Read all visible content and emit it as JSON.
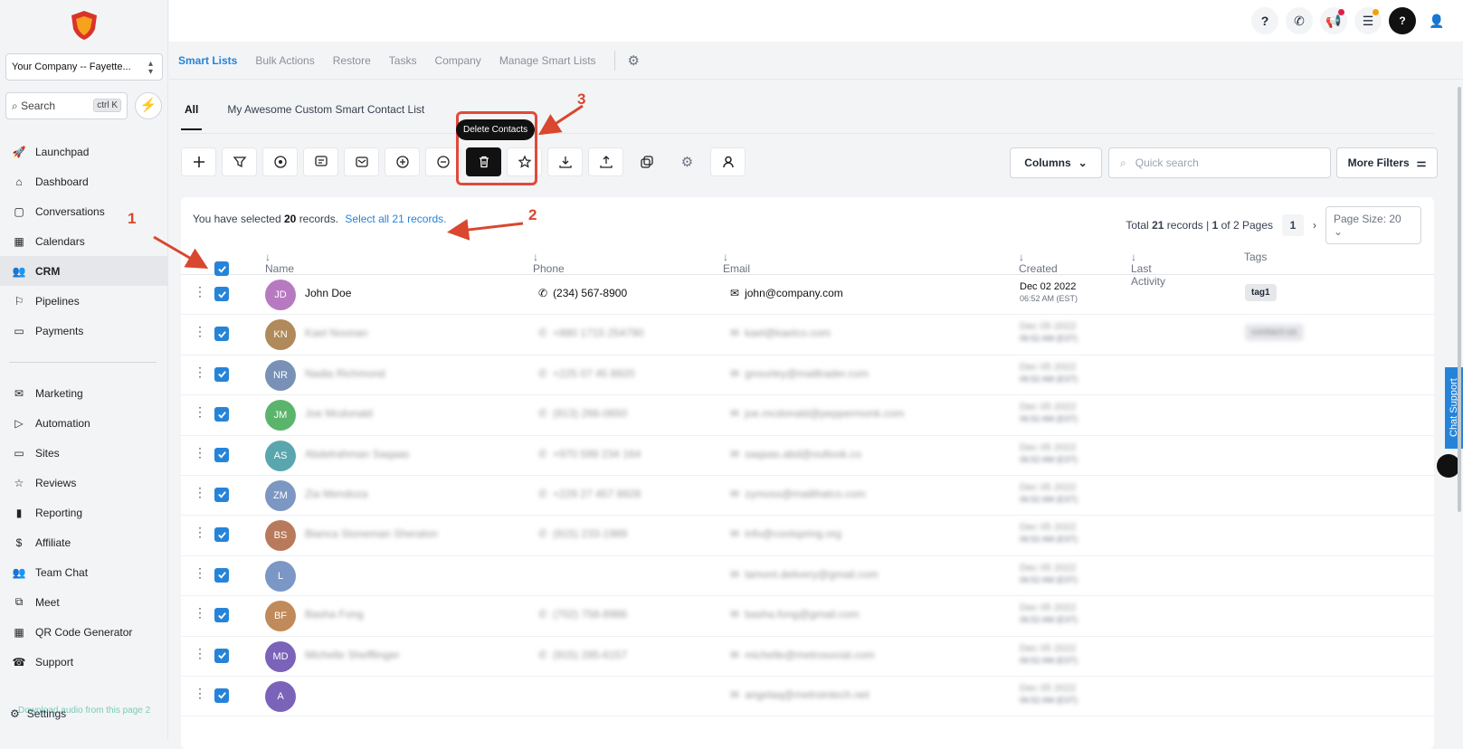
{
  "sidebar": {
    "company": "Your Company -- Fayette...",
    "search_placeholder": "Search",
    "search_shortcut": "ctrl K",
    "nav_primary": [
      {
        "label": "Launchpad",
        "icon": "rocket-icon"
      },
      {
        "label": "Dashboard",
        "icon": "home-icon"
      },
      {
        "label": "Conversations",
        "icon": "chat-icon"
      },
      {
        "label": "Calendars",
        "icon": "calendar-icon"
      },
      {
        "label": "CRM",
        "icon": "users-icon",
        "active": true
      },
      {
        "label": "Pipelines",
        "icon": "flag-icon"
      },
      {
        "label": "Payments",
        "icon": "payments-icon"
      }
    ],
    "nav_secondary": [
      {
        "label": "Marketing",
        "icon": "mail-icon"
      },
      {
        "label": "Automation",
        "icon": "play-icon"
      },
      {
        "label": "Sites",
        "icon": "monitor-icon"
      },
      {
        "label": "Reviews",
        "icon": "star-icon"
      },
      {
        "label": "Reporting",
        "icon": "bar-chart-icon"
      },
      {
        "label": "Affiliate",
        "icon": "dollar-icon"
      },
      {
        "label": "Team Chat",
        "icon": "team-icon"
      },
      {
        "label": "Meet",
        "icon": "cast-icon"
      },
      {
        "label": "QR Code Generator",
        "icon": "qr-icon"
      },
      {
        "label": "Support",
        "icon": "support-icon"
      }
    ],
    "settings_label": "Settings",
    "audio_overlay": "Download audio from this page",
    "audio_overlay_count": "2"
  },
  "tabs_top": [
    "Smart Lists",
    "Bulk Actions",
    "Restore",
    "Tasks",
    "Company",
    "Manage Smart Lists"
  ],
  "tabs_lists": [
    "All",
    "My Awesome Custom Smart Contact List"
  ],
  "tooltip": "Delete Contacts",
  "columns_label": "Columns",
  "quick_search_placeholder": "Quick search",
  "more_filters_label": "More Filters",
  "selection": {
    "prefix": "You have selected",
    "count": "20",
    "suffix": "records.",
    "select_all": "Select all 21 records."
  },
  "pager": {
    "total_prefix": "Total",
    "total": "21",
    "total_mid": "records |",
    "page": "1",
    "of_text": "of 2 Pages",
    "current": "1",
    "page_size": "Page Size: 20"
  },
  "columns": [
    "Name",
    "Phone",
    "Email",
    "Created",
    "Last Activity",
    "Tags"
  ],
  "rows": [
    {
      "initials": "JD",
      "color": "#b77ac1",
      "name": "John Doe",
      "phone": "(234) 567-8900",
      "email": "john@company.com",
      "created": "Dec 02 2022",
      "created_time": "06:52 AM (EST)",
      "tag": "tag1",
      "blurred": false
    },
    {
      "initials": "KN",
      "color": "#b08a5a",
      "name": "Kael Noonan",
      "phone": "+880 1715 254790",
      "email": "kael@kaelco.com",
      "created": "Dec 05 2022",
      "created_time": "06:52 AM (EST)",
      "tag": "contact-us",
      "blurred": true
    },
    {
      "initials": "NR",
      "color": "#7991b7",
      "name": "Nadia Richmond",
      "phone": "+225 07 45 8920",
      "email": "gnourley@mailtrader.com",
      "created": "Dec 05 2022",
      "created_time": "06:52 AM (EST)",
      "tag": "",
      "blurred": true
    },
    {
      "initials": "JM",
      "color": "#5bb46c",
      "name": "Joe Mcdonald",
      "phone": "(913) 266-0650",
      "email": "joe.mcdonald@peppermonk.com",
      "created": "Dec 05 2022",
      "created_time": "06:52 AM (EST)",
      "tag": "",
      "blurred": true
    },
    {
      "initials": "AS",
      "color": "#5aa6ae",
      "name": "Abdelrahman Saqaas",
      "phone": "+970 599 234 164",
      "email": "saqaas.abd@outlook.co",
      "created": "Dec 05 2022",
      "created_time": "06:52 AM (EST)",
      "tag": "",
      "blurred": true
    },
    {
      "initials": "ZM",
      "color": "#7c97c2",
      "name": "Zia Mendoza",
      "phone": "+229 27 457 8928",
      "email": "zymoss@mailthatco.com",
      "created": "Dec 05 2022",
      "created_time": "06:52 AM (EST)",
      "tag": "",
      "blurred": true
    },
    {
      "initials": "BS",
      "color": "#b97a5c",
      "name": "Bianca Stoneman Sheraton",
      "phone": "(915) 233-1989",
      "email": "info@coolspring.org",
      "created": "Dec 05 2022",
      "created_time": "06:52 AM (EST)",
      "tag": "",
      "blurred": true
    },
    {
      "initials": "L",
      "color": "#7b97c6",
      "name": "",
      "phone": "",
      "email": "lamont.delivery@gmail.com",
      "created": "Dec 05 2022",
      "created_time": "06:52 AM (EST)",
      "tag": "",
      "blurred": true
    },
    {
      "initials": "BF",
      "color": "#c08a5a",
      "name": "Basha Fong",
      "phone": "(702) 758-8986",
      "email": "basha.fong@gmail.com",
      "created": "Dec 05 2022",
      "created_time": "06:52 AM (EST)",
      "tag": "",
      "blurred": true
    },
    {
      "initials": "MD",
      "color": "#7a63b8",
      "name": "Michelle Shefflinger",
      "phone": "(915) 285-6157",
      "email": "michelle@metrosocial.com",
      "created": "Dec 05 2022",
      "created_time": "06:52 AM (EST)",
      "tag": "",
      "blurred": true
    },
    {
      "initials": "A",
      "color": "#7a63b8",
      "name": "",
      "phone": "",
      "email": "angelaq@metrointech.net",
      "created": "Dec 05 2022",
      "created_time": "06:52 AM (EST)",
      "tag": "",
      "blurred": true
    }
  ],
  "annotations": [
    "1",
    "2",
    "3"
  ],
  "chat_support": "Chat Support",
  "colors": {
    "accent": "#2684d8",
    "annotation": "#d9472f"
  }
}
